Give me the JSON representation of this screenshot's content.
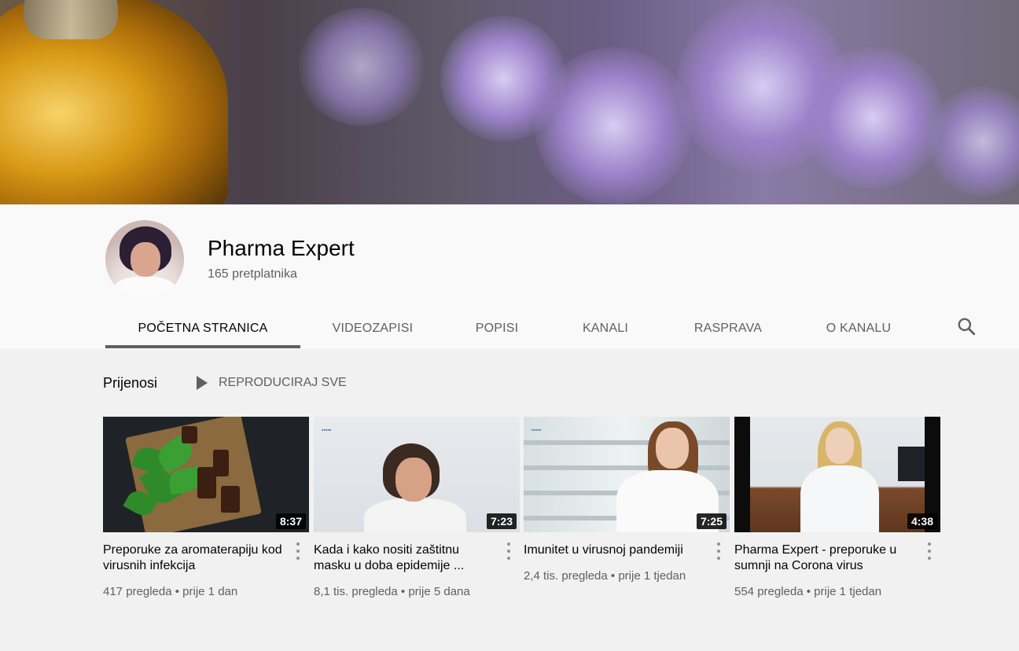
{
  "channel": {
    "name": "Pharma Expert",
    "subscribers": "165 pretplatnika"
  },
  "tabs": [
    {
      "label": "POČETNA STRANICA",
      "active": true
    },
    {
      "label": "VIDEOZAPISI",
      "active": false
    },
    {
      "label": "POPISI",
      "active": false
    },
    {
      "label": "KANALI",
      "active": false
    },
    {
      "label": "RASPRAVA",
      "active": false
    },
    {
      "label": "O KANALU",
      "active": false
    }
  ],
  "search_icon": "search-icon",
  "section": {
    "title": "Prijenosi",
    "play_all": "REPRODUCIRAJ SVE"
  },
  "videos": [
    {
      "duration": "8:37",
      "title": "Preporuke za aromaterapiju kod virusnih infekcija",
      "views": "417 pregleda",
      "age": "prije 1 dan"
    },
    {
      "duration": "7:23",
      "title": "Kada i kako nositi zaštitnu masku u doba epidemije ...",
      "views": "8,1 tis. pregleda",
      "age": "prije 5 dana"
    },
    {
      "duration": "7:25",
      "title": "Imunitet u virusnoj pandemiji",
      "views": "2,4 tis. pregleda",
      "age": "prije 1 tjedan"
    },
    {
      "duration": "4:38",
      "title": "Pharma Expert - preporuke u sumnji na Corona virus",
      "views": "554 pregleda",
      "age": "prije 1 tjedan"
    }
  ],
  "colors": {
    "text_primary": "#030303",
    "text_secondary": "#606060",
    "background": "#f1f1f1",
    "header_background": "#f9f9f9"
  }
}
